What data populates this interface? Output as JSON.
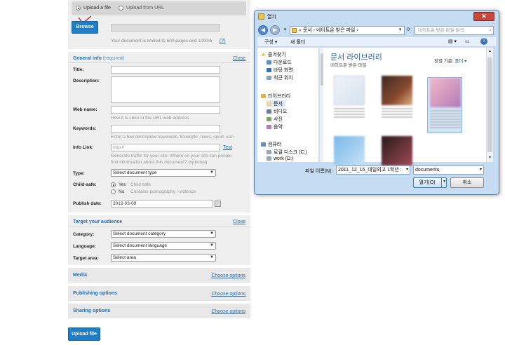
{
  "upload": {
    "option_file": "Upload a file",
    "option_url": "Upload from URL",
    "browse_label": "Browse",
    "limit_text": "Your document is limited to 500 pages and 100mb",
    "help_link": "(?)"
  },
  "general": {
    "heading": "General info",
    "required": "(required)",
    "close": "Close",
    "title_label": "Title:",
    "description_label": "Description:",
    "webname_label": "Web name:",
    "webname_hint": "How it is seen in the URL web address.",
    "keywords_label": "Keywords:",
    "keywords_hint": "Enter a few descriptive keywords. Example: news, sport, sun",
    "infolink_label": "Info Link:",
    "infolink_placeholder": "http://",
    "test_link": "Test",
    "infolink_hint1": "Generate traffic for your site. Where on your site can people",
    "infolink_hint2": "find information about this document? (optional)",
    "type_label": "Type:",
    "type_value": "Select document type",
    "childsafe_label": "Child-safe:",
    "yes_label": "Yes",
    "yes_hint": "Child safe",
    "no_label": "No",
    "no_hint": "Contains pornography / violence",
    "publish_label": "Publish date:",
    "publish_value": "2012-03-09"
  },
  "audience": {
    "heading": "Target your audience",
    "close": "Close",
    "category_label": "Category:",
    "category_value": "Select document category",
    "language_label": "Language:",
    "language_value": "Select document language",
    "area_label": "Target area:",
    "area_value": "Select area"
  },
  "sections": [
    {
      "heading": "Media",
      "link": "Choose options"
    },
    {
      "heading": "Publishing options",
      "link": "Choose options"
    },
    {
      "heading": "Sharing options",
      "link": "Choose options"
    }
  ],
  "upload_button": "Upload file",
  "dialog": {
    "title": "열기",
    "address": "« 문서 › 네이트온 받은 파일 ›",
    "search_placeholder": "네이트온 받은 파일 검색",
    "organize": "구성 ▾",
    "new_folder": "새 폴더",
    "nav": [
      "즐겨찾기",
      "다운로드",
      "바탕 화면",
      "최근 위치",
      "라이브러리",
      "문서",
      "비디오",
      "사진",
      "음악",
      "컴퓨터",
      "로컬 디스크 (C:)",
      "work (D:)"
    ],
    "library_title": "문서 라이브러리",
    "library_subtitle": "네이트온 받은 파일",
    "arrange_label": "정렬 기준:",
    "arrange_value": "폴더 ▾",
    "filename_label": "파일 이름(N):",
    "filename_value": "2011_12_16_대일외고 1학년 :",
    "filetype_value": "documents",
    "open_button": "열기(O)",
    "cancel_button": "취소"
  },
  "colors": {
    "accent": "#1e7ec8",
    "link": "#1f6fb8",
    "dialog_frame": "#c6dcf2"
  }
}
